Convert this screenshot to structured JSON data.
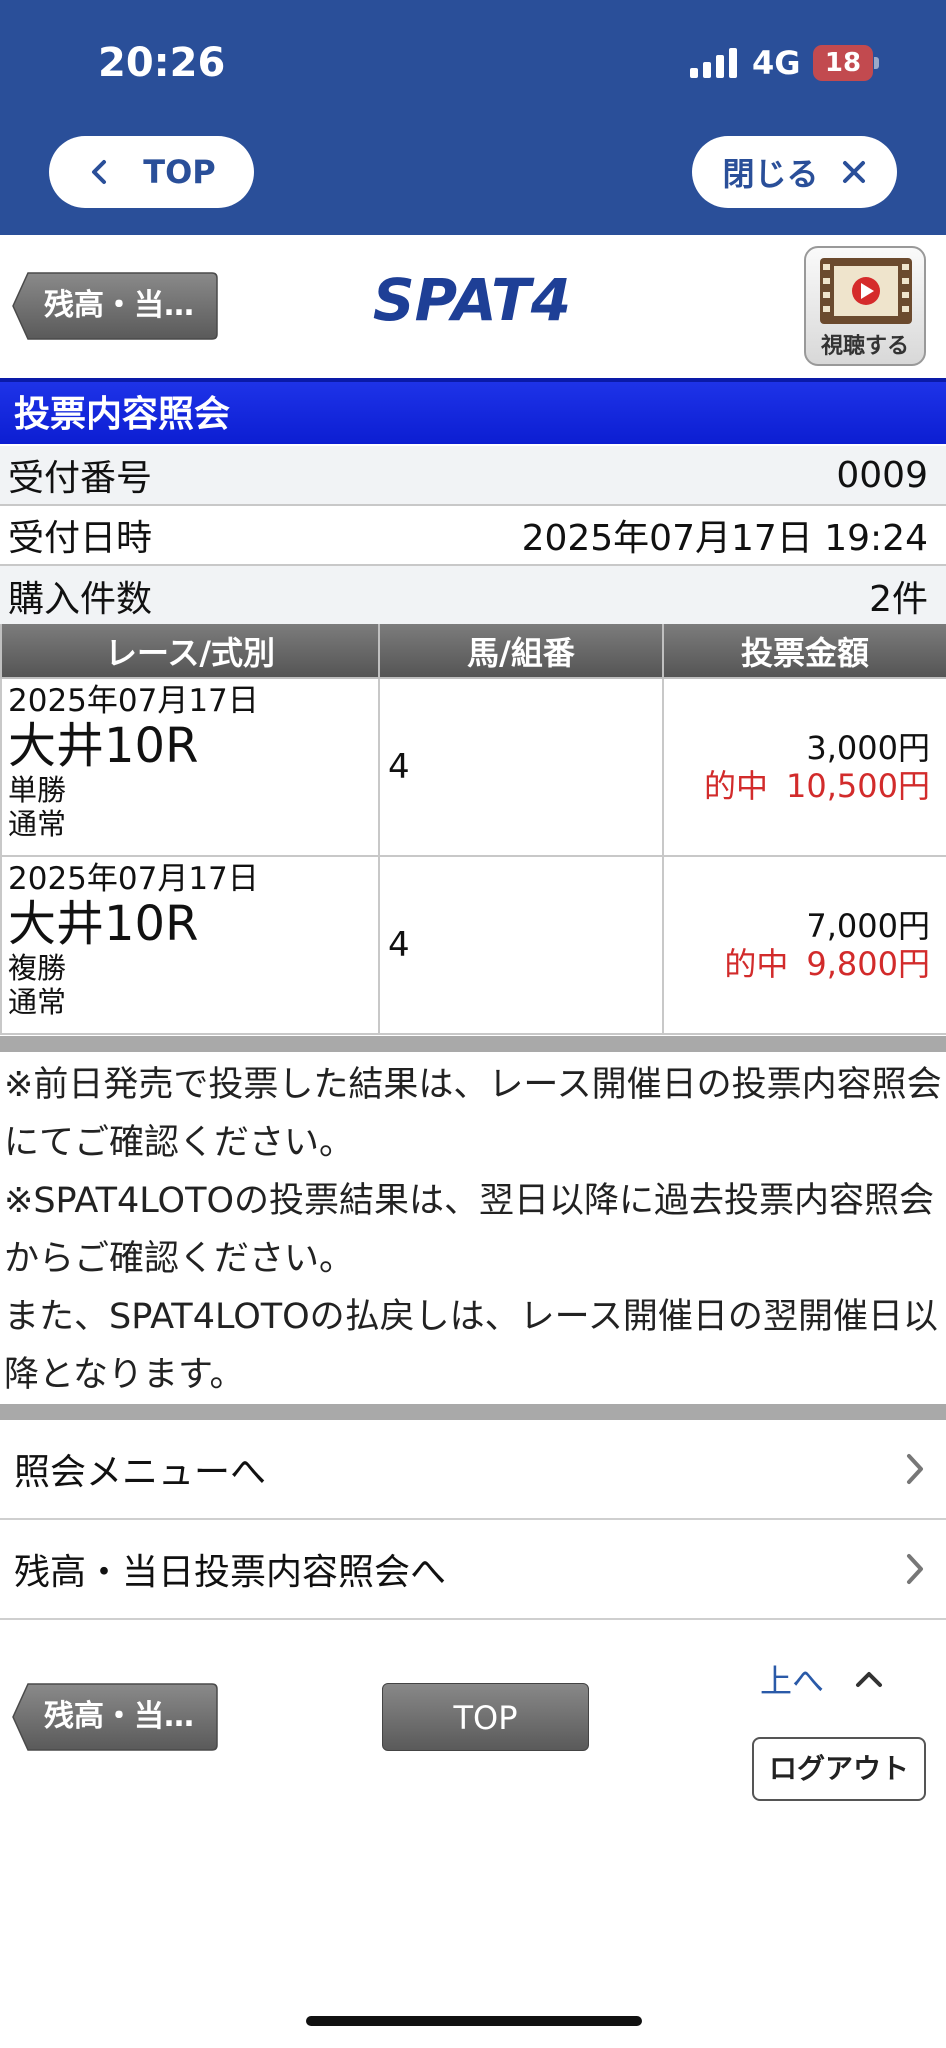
{
  "status_bar": {
    "time": "20:26",
    "network": "4G",
    "battery_level": "18"
  },
  "header": {
    "top_button": "TOP",
    "close_button": "閉じる"
  },
  "logo_row": {
    "back_button": "残高・当…",
    "logo_text": "SPAT4",
    "view_button": "視聴する"
  },
  "section": {
    "title": "投票内容照会"
  },
  "info": [
    {
      "label": "受付番号",
      "value": "0009"
    },
    {
      "label": "受付日時",
      "value": "2025年07月17日 19:24"
    },
    {
      "label": "購入件数",
      "value": "2件"
    }
  ],
  "table": {
    "headers": [
      "レース/式別",
      "馬/組番",
      "投票金額"
    ],
    "rows": [
      {
        "date": "2025年07月17日",
        "race": "大井10R",
        "bet_type": "単勝",
        "mode": "通常",
        "horse": "4",
        "amount": "3,000円",
        "hit_label": "的中",
        "payout": "10,500円"
      },
      {
        "date": "2025年07月17日",
        "race": "大井10R",
        "bet_type": "複勝",
        "mode": "通常",
        "horse": "4",
        "amount": "7,000円",
        "hit_label": "的中",
        "payout": "9,800円"
      }
    ]
  },
  "notes": {
    "line1": "※前日発売で投票した結果は、レース開催日の投票内容照会にてご確認ください。",
    "line2": "※SPAT4LOTOの投票結果は、翌日以降に過去投票内容照会からご確認ください。",
    "line3": "また、SPAT4LOTOの払戻しは、レース開催日の翌開催日以降となります。"
  },
  "nav": [
    {
      "label": "照会メニューへ"
    },
    {
      "label": "残高・当日投票内容照会へ"
    }
  ],
  "footer": {
    "back_button": "残高・当…",
    "top_button": "TOP",
    "back_to_top": "上へ",
    "logout": "ログアウト"
  },
  "colors": {
    "header_blue": "#2a4f99",
    "section_blue": "#1e33e8",
    "hit_red": "#d22b2b"
  }
}
